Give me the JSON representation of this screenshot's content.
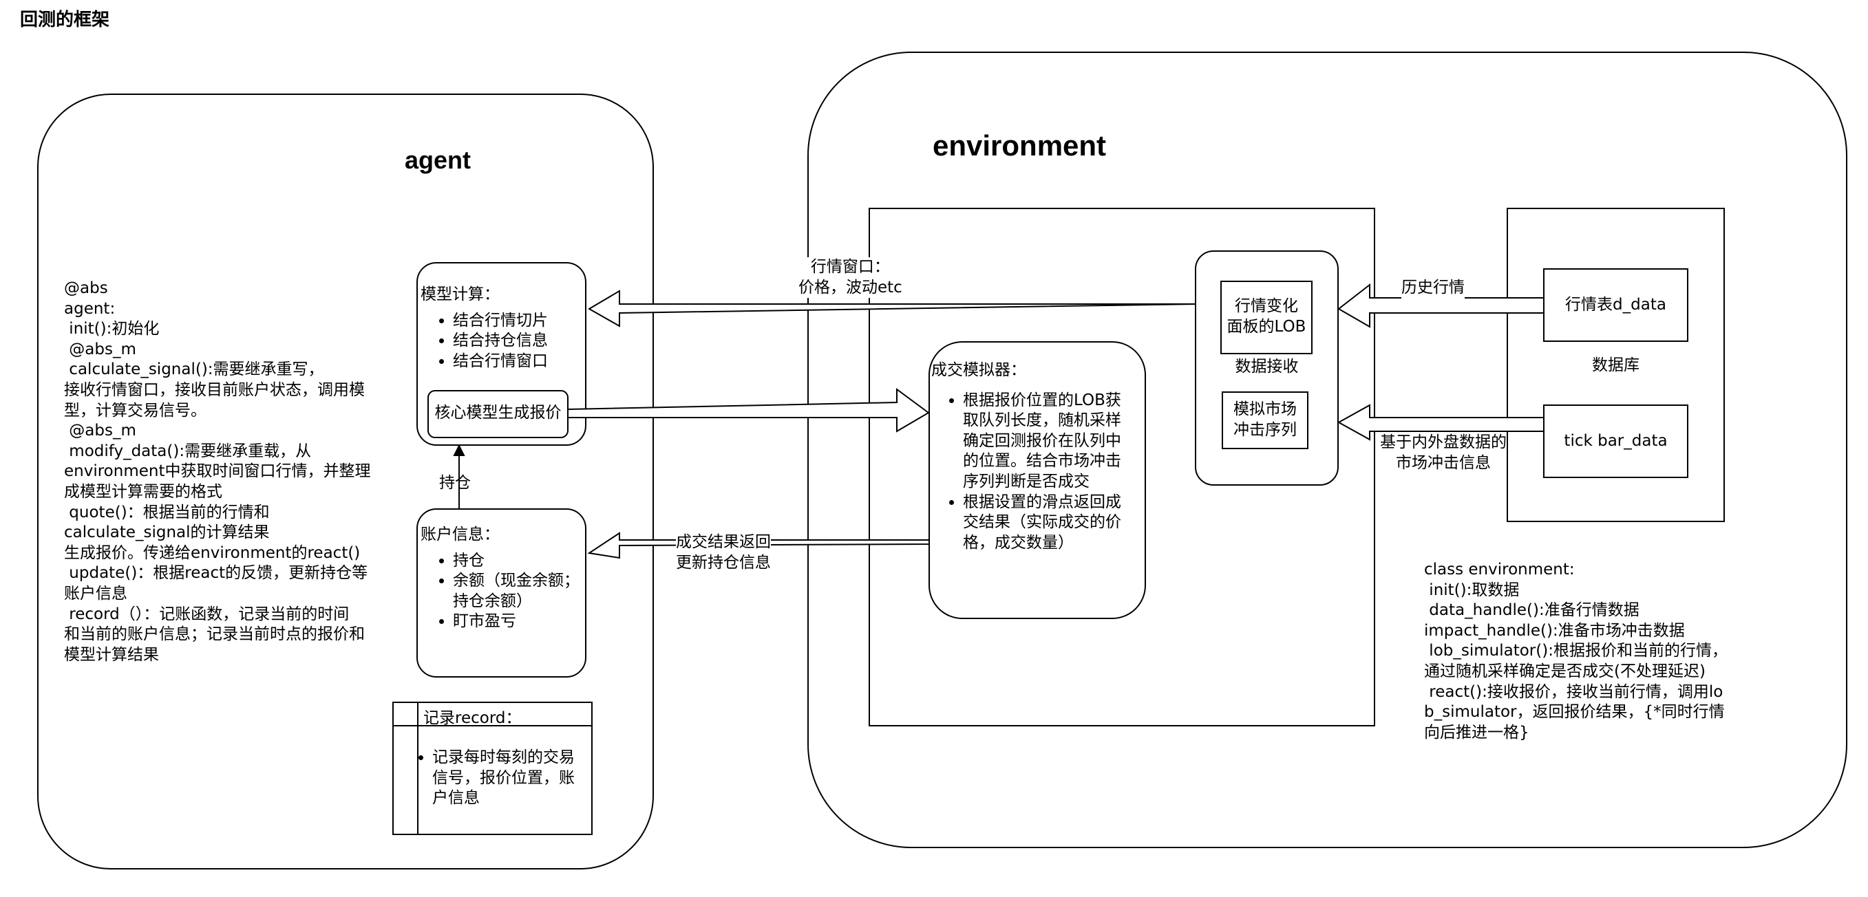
{
  "page_title": "回测的框架",
  "agent": {
    "title": "agent",
    "notes": "@abs\nagent:\n init():初始化\n @abs_m\n calculate_signal():需要继承重写，\n接收行情窗口，接收目前账户状态，调用模\n型，计算交易信号。\n @abs_m\n modify_data():需要继承重载，从\nenvironment中获取时间窗口行情，并整理\n成模型计算需要的格式\n quote()：根据当前的行情和\ncalculate_signal的计算结果\n生成报价。传递给environment的react()\n update()：根据react的反馈，更新持仓等\n账户信息\n record（）：记账函数，记录当前的时间\n和当前的账户信息；记录当前时点的报价和\n模型计算结果",
    "model_box": {
      "title": "模型计算：",
      "items": [
        "结合行情切片",
        "结合持仓信息",
        "结合行情窗口"
      ],
      "core": "核心模型生成报价"
    },
    "account_box": {
      "title": "账户信息：",
      "items": [
        "持仓",
        "余额（现金余额；持仓余额）",
        "盯市盈亏"
      ]
    },
    "record_box": {
      "title": "记录record：",
      "items": [
        "记录每时每刻的交易信号，报价位置，账户信息"
      ]
    },
    "position_label": "持仓"
  },
  "environment": {
    "title": "environment",
    "matcher": {
      "title": "成交模拟器：",
      "items": [
        "根据报价位置的LOB获取队列长度，随机采样确定回测报价在队列中的位置。结合市场冲击序列判断是否成交",
        "根据设置的滑点返回成交结果（实际成交的价格，成交数量）"
      ]
    },
    "receiver": {
      "lob": "行情变化\n面板的LOB",
      "caption": "数据接收",
      "impact": "模拟市场\n冲击序列"
    },
    "database": {
      "caption": "数据库",
      "table1": "行情表d_data",
      "table2": "tick bar_data"
    },
    "notes": "class environment:\n init():取数据\n data_handle():准备行情数据\nimpact_handle():准备市场冲击数据\n lob_simulator():根据报价和当前的行情，\n通过随机采样确定是否成交(不处理延迟)\n react():接收报价，接收当前行情，调用lo\nb_simulator，返回报价结果，{*同时行情\n向后推进一格}"
  },
  "arrows": {
    "window_label": "行情窗口：\n价格，波动etc",
    "result_label": "成交结果返回\n更新持仓信息",
    "history_label": "历史行情",
    "impact_label": "基于内外盘数据的\n市场冲击信息"
  }
}
